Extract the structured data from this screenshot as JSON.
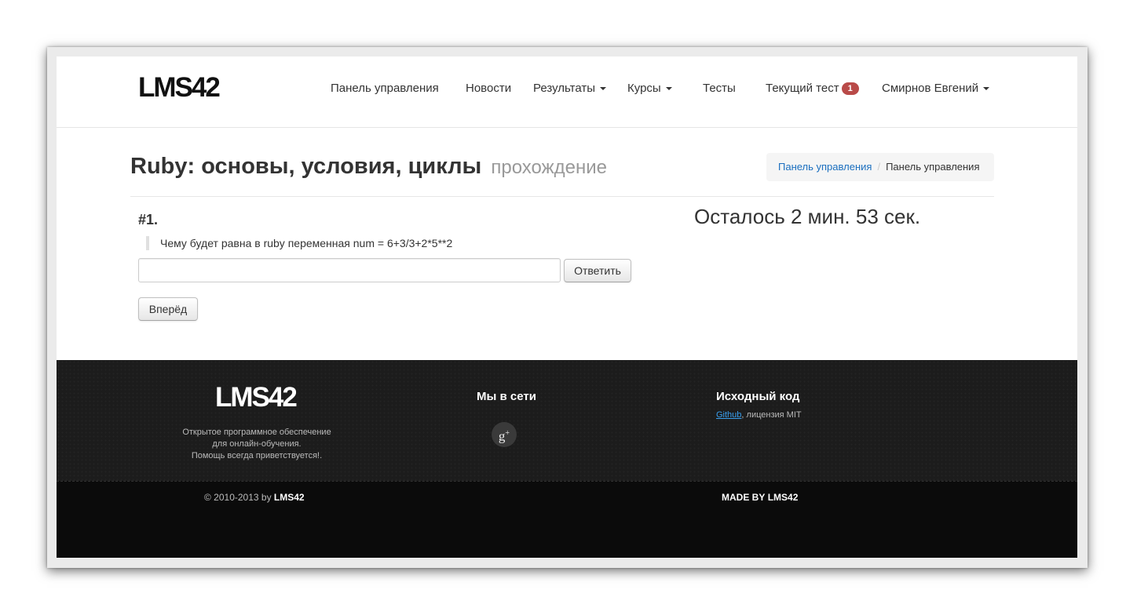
{
  "header": {
    "brand": "LMS42",
    "nav": {
      "dashboard": "Панель управления",
      "news": "Новости",
      "results": "Результаты",
      "courses": "Курсы",
      "tests": "Тесты",
      "current_test": "Текущий тест",
      "current_test_badge": "1",
      "user": "Смирнов Евгений"
    }
  },
  "main": {
    "title": "Ruby: основы, условия, циклы",
    "subtitle": "прохождение",
    "breadcrumb": [
      "Панель управления",
      "Панель управления"
    ],
    "breadcrumb_separator": "/",
    "question_number": "#1.",
    "question_text": "Чему будет равна в ruby переменная num = 6+3/3+2*5**2",
    "answer_value": "",
    "answer_button": "Ответить",
    "next_button": "Вперёд",
    "timer": "Осталось 2 мин. 53 сек."
  },
  "footer": {
    "brand": "LMS42",
    "description": [
      "Открытое программное обеспечение",
      "для онлайн-обучения.",
      "Помощь всегда приветствуется!."
    ],
    "social_heading": "Мы в сети",
    "social_icon": "google-plus-icon",
    "source_heading": "Исходный код",
    "source_link": "Github",
    "source_suffix": ", лицензия MIT",
    "copyright_prefix": "© 2010-2013 by",
    "copyright_brand": "LMS42",
    "made_prefix": "MADE BY",
    "made_brand": "LMS42"
  },
  "colors": {
    "badge": "#b94a48",
    "link": "#1b6fbf",
    "footer_bg": "#1c1c1c",
    "footer_bottom_bg": "#0b0b0b"
  }
}
